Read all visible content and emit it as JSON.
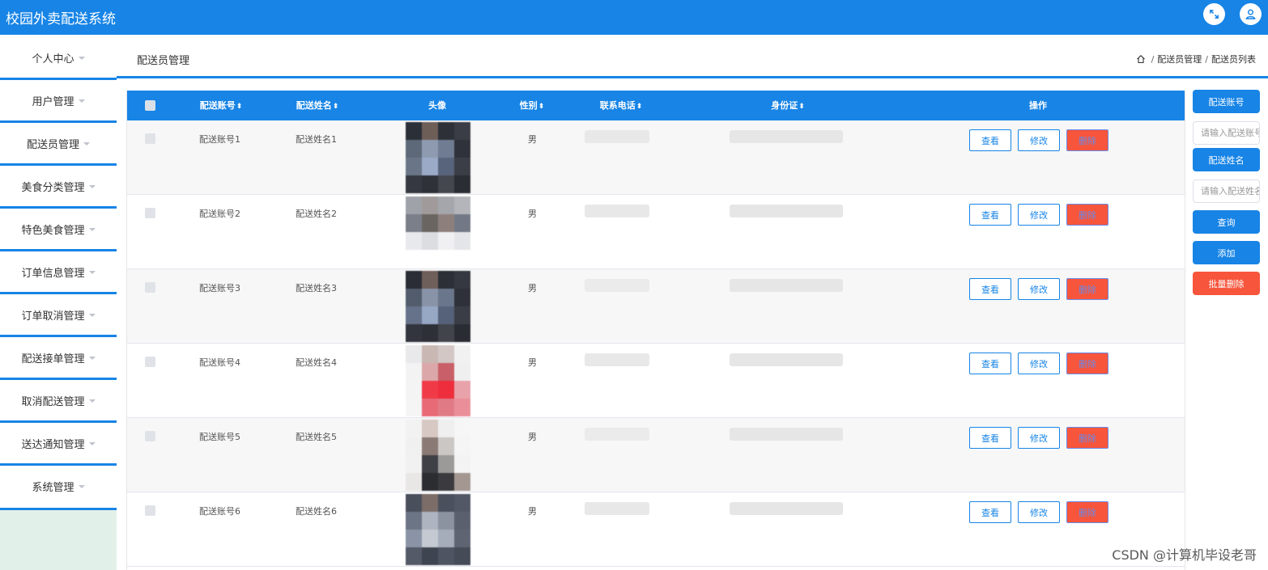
{
  "app": {
    "title": "校园外卖配送系统"
  },
  "sidebar": {
    "items": [
      {
        "label": "个人中心"
      },
      {
        "label": "用户管理"
      },
      {
        "label": "配送员管理"
      },
      {
        "label": "美食分类管理"
      },
      {
        "label": "特色美食管理"
      },
      {
        "label": "订单信息管理"
      },
      {
        "label": "订单取消管理"
      },
      {
        "label": "配送接单管理"
      },
      {
        "label": "取消配送管理"
      },
      {
        "label": "送达通知管理"
      },
      {
        "label": "系统管理"
      }
    ]
  },
  "header": {
    "page_title": "配送员管理",
    "breadcrumb": [
      "配送员管理",
      "配送员列表"
    ]
  },
  "table": {
    "columns": [
      {
        "label": "配送账号",
        "sortable": true
      },
      {
        "label": "配送姓名",
        "sortable": true
      },
      {
        "label": "头像",
        "sortable": false
      },
      {
        "label": "性别",
        "sortable": true
      },
      {
        "label": "联系电话",
        "sortable": true
      },
      {
        "label": "身份证",
        "sortable": true
      },
      {
        "label": "操作",
        "sortable": false
      }
    ],
    "sort_glyph": "⬍",
    "rows": [
      {
        "account": "配送账号1",
        "name": "配送姓名1",
        "gender": "男"
      },
      {
        "account": "配送账号2",
        "name": "配送姓名2",
        "gender": "男"
      },
      {
        "account": "配送账号3",
        "name": "配送姓名3",
        "gender": "男"
      },
      {
        "account": "配送账号4",
        "name": "配送姓名4",
        "gender": "男"
      },
      {
        "account": "配送账号5",
        "name": "配送姓名5",
        "gender": "男"
      },
      {
        "account": "配送账号6",
        "name": "配送姓名6",
        "gender": "男"
      }
    ],
    "actions": {
      "view": "查看",
      "edit": "修改",
      "delete": "删除"
    }
  },
  "search": {
    "account_label": "配送账号",
    "account_placeholder": "请输入配送账号",
    "name_label": "配送姓名",
    "name_placeholder": "请输入配送姓名",
    "query_button": "查询",
    "add_button": "添加",
    "batch_delete_button": "批量删除"
  },
  "watermark": "CSDN @计算机毕设老哥",
  "colors": {
    "primary": "#1784e6",
    "danger": "#f7553c",
    "row_alt": "#f7f7f7",
    "sidebar_fill": "#e2f0ea"
  },
  "icons": {
    "fullscreen": "fullscreen-icon",
    "user": "user-icon",
    "home": "home-icon",
    "caret": "caret-down-icon"
  }
}
